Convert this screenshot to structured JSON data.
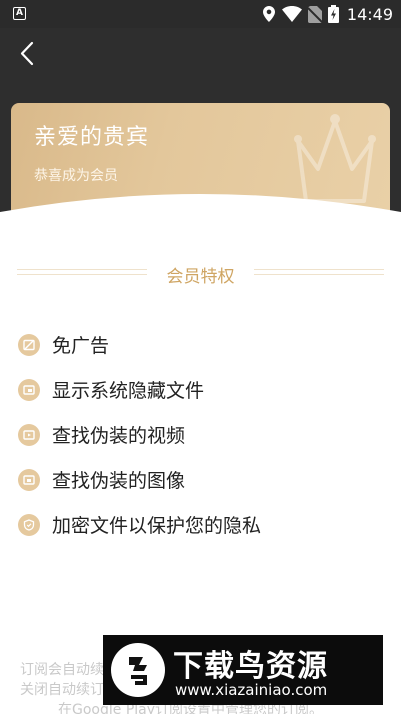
{
  "status_bar": {
    "time": "14:49",
    "icons": [
      "app-a-icon",
      "location-icon",
      "wifi-icon",
      "no-sim-icon",
      "battery-charging-icon"
    ]
  },
  "header": {
    "back_icon": "chevron-left-icon"
  },
  "vip_card": {
    "title": "亲爱的贵宾",
    "subtitle": "恭喜成为会员",
    "decoration_icon": "crown-icon"
  },
  "privileges": {
    "section_title": "会员特权",
    "items": [
      {
        "label": "免广告",
        "icon": "no-ads-icon"
      },
      {
        "label": "显示系统隐藏文件",
        "icon": "folder-icon"
      },
      {
        "label": "查找伪装的视频",
        "icon": "video-icon"
      },
      {
        "label": "查找伪装的图像",
        "icon": "image-icon"
      },
      {
        "label": "加密文件以保护您的隐私",
        "icon": "shield-icon"
      }
    ]
  },
  "footer": {
    "line1": "订阅会自动续",
    "line2": "关闭自动续订",
    "line3": "在Google Play订阅设置中管理您的订阅。"
  },
  "watermark": {
    "title": "下载鸟资源",
    "url": "www.xiazainiao.com"
  },
  "colors": {
    "accent_gold": "#cfa563",
    "card_gold": "#e3c79b",
    "header_dark": "#2e2e2e"
  }
}
